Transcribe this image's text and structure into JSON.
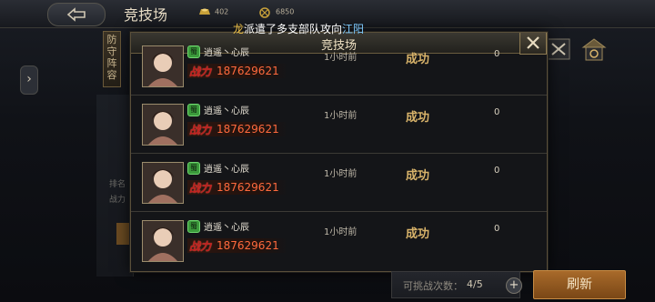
{
  "header": {
    "back_icon": "back-arrow-icon",
    "title": "竞技场",
    "resources": [
      {
        "icon": "gold-ingot-icon",
        "value": "402",
        "color": "#c9a23a"
      },
      {
        "icon": "token-coin-icon",
        "value": "6850",
        "color": "#c9a23a"
      }
    ]
  },
  "ticker": {
    "prefix": "龙",
    "text": "派遣了多支部队攻向",
    "place": "江阳"
  },
  "background": {
    "defense_label": "防守阵容",
    "rank_label": "排名",
    "power_label": "战力",
    "right_icons": [
      "battle-report-icon",
      "shop-icon"
    ]
  },
  "modal": {
    "title": "竞技场",
    "rows": [
      {
        "name": "逍遥丶心辰",
        "power_label": "战力",
        "power": "187629621",
        "time": "1小时前",
        "result": "成功",
        "change": "0"
      },
      {
        "name": "逍遥丶心辰",
        "power_label": "战力",
        "power": "187629621",
        "time": "1小时前",
        "result": "成功",
        "change": "0"
      },
      {
        "name": "逍遥丶心辰",
        "power_label": "战力",
        "power": "187629621",
        "time": "1小时前",
        "result": "成功",
        "change": "0"
      },
      {
        "name": "逍遥丶心辰",
        "power_label": "战力",
        "power": "187629621",
        "time": "1小时前",
        "result": "成功",
        "change": "0"
      }
    ]
  },
  "footer": {
    "challenges_label": "可挑战次数：",
    "challenges_value": "4/5",
    "refresh_label": "刷新"
  },
  "colors": {
    "accent_gold": "#d8b36a",
    "power_red": "#ff6a3d",
    "refresh_orange": "#a86a2a"
  }
}
